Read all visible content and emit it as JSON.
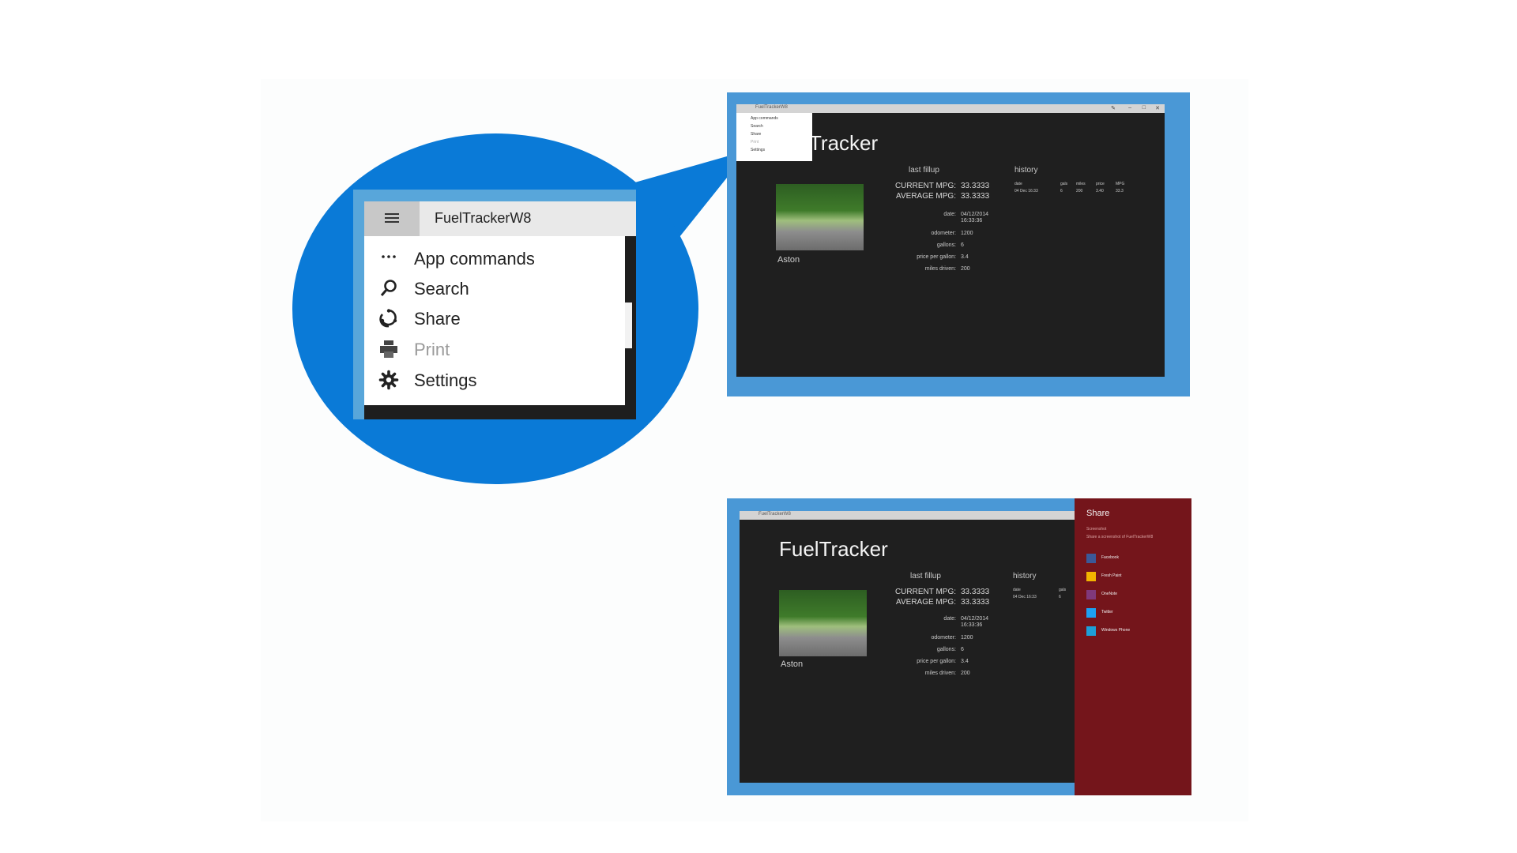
{
  "magnifier": {
    "window_title": "FuelTrackerW8",
    "menu_items": [
      {
        "label": "App commands",
        "icon": "more-dots-icon",
        "disabled": false
      },
      {
        "label": "Search",
        "icon": "search-icon",
        "disabled": false
      },
      {
        "label": "Share",
        "icon": "share-icon",
        "disabled": false
      },
      {
        "label": "Print",
        "icon": "print-icon",
        "disabled": true
      },
      {
        "label": "Settings",
        "icon": "gear-icon",
        "disabled": false
      }
    ]
  },
  "app": {
    "title": "FuelTracker",
    "title_partial": "Tracker",
    "car_name": "Aston",
    "last_fillup_heading": "last fillup",
    "history_heading": "history",
    "current_mpg_label": "CURRENT MPG:",
    "current_mpg_value": "33.3333",
    "average_mpg_label": "AVERAGE MPG:",
    "average_mpg_value": "33.3333",
    "fields": [
      {
        "label": "date:",
        "value": "04/12/2014",
        "value2": "16:33:36"
      },
      {
        "label": "odometer:",
        "value": "1200"
      },
      {
        "label": "gallons:",
        "value": "6"
      },
      {
        "label": "price per gallon:",
        "value": "3.4"
      },
      {
        "label": "miles driven:",
        "value": "200"
      }
    ],
    "history_columns": [
      "date",
      "gals",
      "miles",
      "price",
      "MPG"
    ],
    "history_row": [
      "04 Dec 16:33",
      "6",
      "200",
      "3.40",
      "33.3"
    ],
    "history_row_short": [
      "04 Dec 16:33",
      "6"
    ]
  },
  "share": {
    "heading": "Share",
    "subheading": "Screenshot",
    "description": "Share a screenshot of FuelTrackerW8",
    "targets": [
      {
        "name": "Facebook",
        "color": "#3b5998"
      },
      {
        "name": "Fresh Paint",
        "color": "#f2b400"
      },
      {
        "name": "OneNote",
        "color": "#80397b"
      },
      {
        "name": "Twitter",
        "color": "#1da1f2"
      },
      {
        "name": "Windows Phone",
        "color": "#1e9fd8"
      }
    ]
  },
  "colors": {
    "accent_blue": "#0a7ad7",
    "frame_blue": "#4a98d6",
    "app_background": "#1f1f1f",
    "share_red": "#74151b"
  }
}
